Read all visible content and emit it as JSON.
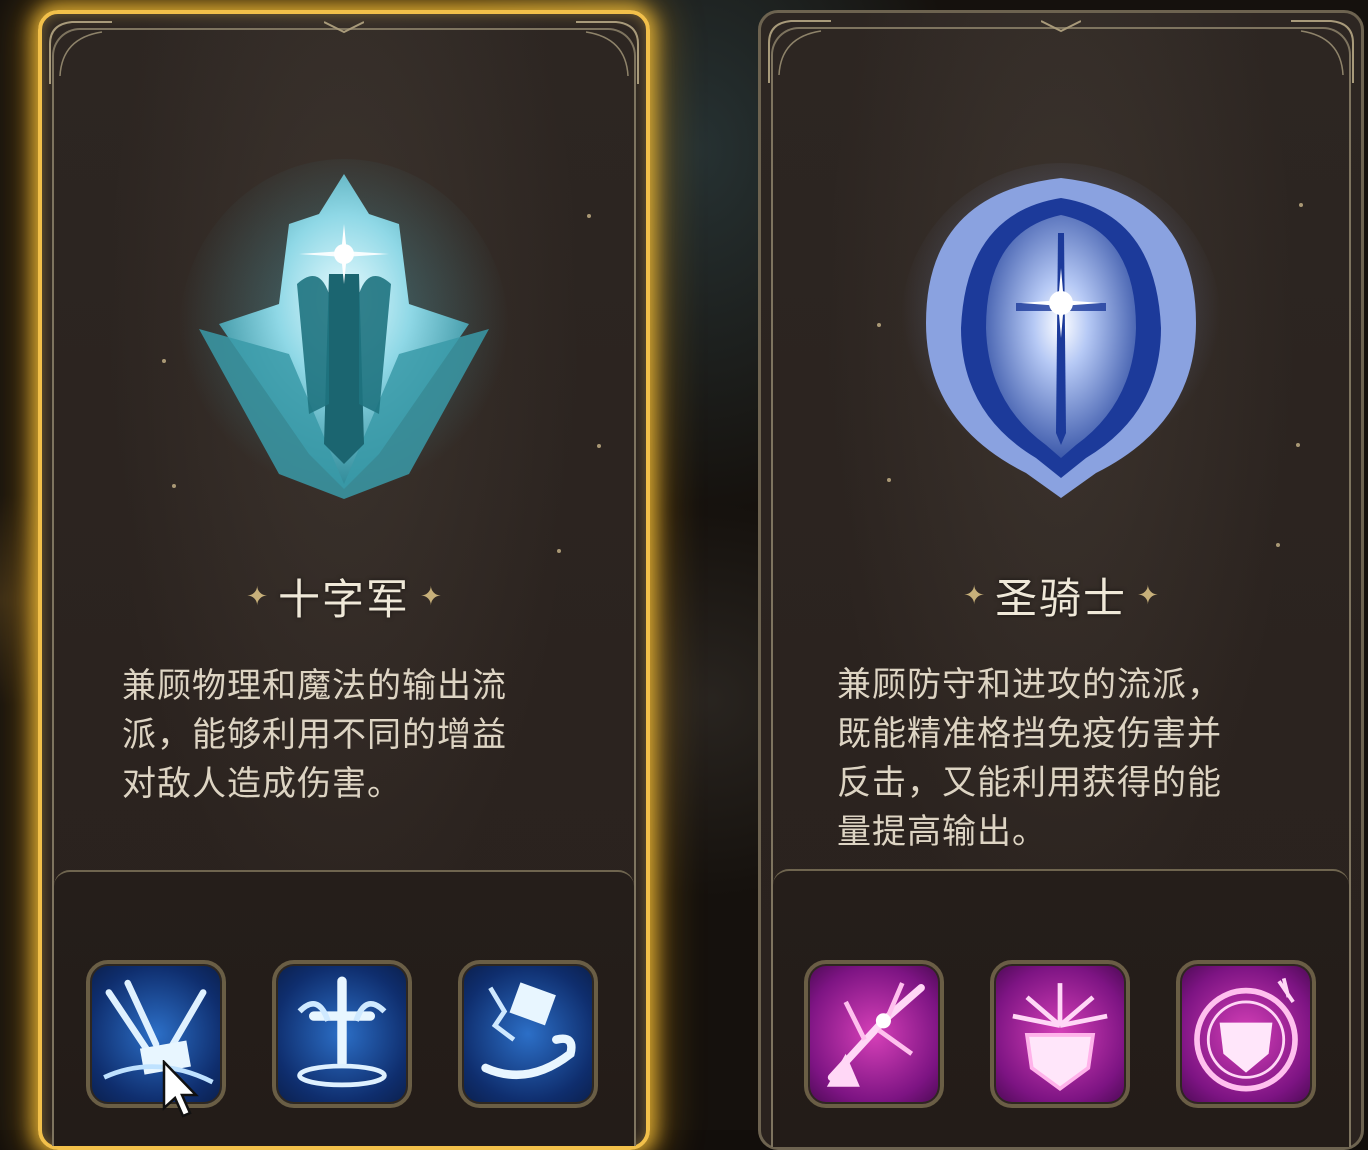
{
  "cards": [
    {
      "id": "crusader",
      "selected": true,
      "name": "十字军",
      "description_lines": [
        "兼顾物理和魔法的输出流",
        "派，能够利用不同的增益",
        "对敌人造成伤害。"
      ],
      "emblem_icon": "crusader-shield-emblem",
      "emblem_color": "#7fd2e0",
      "skills": [
        {
          "icon": "hammer-strike-skill-icon",
          "theme": "blue"
        },
        {
          "icon": "holy-cross-totem-skill-icon",
          "theme": "blue"
        },
        {
          "icon": "hammer-swirl-skill-icon",
          "theme": "blue"
        }
      ]
    },
    {
      "id": "paladin",
      "selected": false,
      "name": "圣骑士",
      "description_lines": [
        "兼顾防守和进攻的流派，",
        "既能精准格挡免疫伤害并",
        "反击，又能利用获得的能",
        "量提高输出。"
      ],
      "emblem_icon": "paladin-shield-emblem",
      "emblem_color": "#6a8fe0",
      "skills": [
        {
          "icon": "piercing-burst-skill-icon",
          "theme": "pink"
        },
        {
          "icon": "shield-arrows-skill-icon",
          "theme": "pink"
        },
        {
          "icon": "shield-aura-skill-icon",
          "theme": "pink"
        }
      ]
    }
  ],
  "colors": {
    "selected_border": "#f2c04a",
    "card_border": "#6d6350",
    "skill_blue": "#2c6fc7",
    "skill_pink": "#d640b8"
  }
}
